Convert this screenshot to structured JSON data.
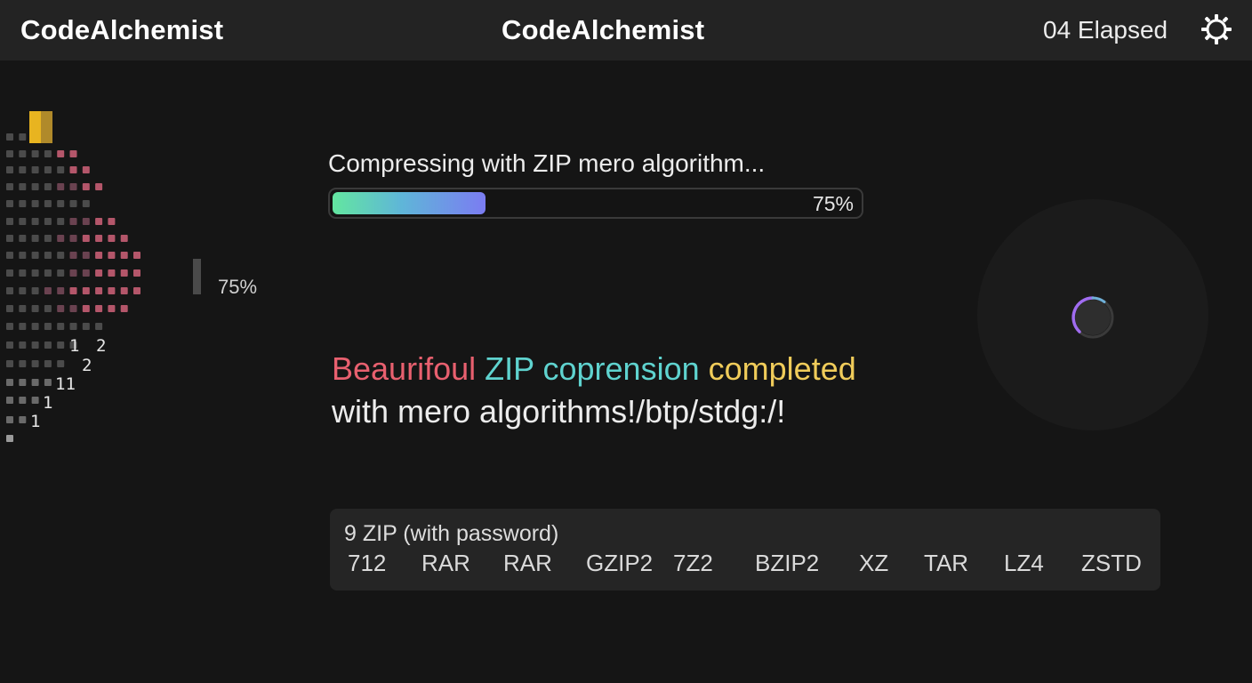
{
  "header": {
    "app_name_left": "CodeAlchemist",
    "app_name_center": "CodeAlchemist",
    "elapsed": "04 Elapsed",
    "settings_icon": "gear-icon"
  },
  "side_panel": {
    "percent": "75%",
    "grid_numbers": [
      "1",
      "2",
      "2",
      "11",
      "1",
      "1"
    ],
    "colors": {
      "bar_yellow": "#e8b420",
      "dot_pink": "#b4566a",
      "dot_gray": "#4b4b4b"
    }
  },
  "compress": {
    "label": "Compressing with ZIP mero algorithm...",
    "progress": 0.75,
    "progress_text": "75%"
  },
  "message": {
    "line1_parts": [
      {
        "text": "Beaurifoul",
        "color": "#e8606f"
      },
      {
        "text": "ZIP",
        "color": "#5fd3cf"
      },
      {
        "text": "coprension",
        "color": "#5fd3cf"
      },
      {
        "text": "completed",
        "color": "#f0cc5a"
      }
    ],
    "line2": "with mero algorithms!/btp/stdg:/!"
  },
  "spinner": {
    "icon": "loading-spinner-icon",
    "accent": "#a06cf0"
  },
  "formats": {
    "title": "9 ZIP (with password)",
    "items": [
      "712",
      "RAR",
      "RAR",
      "GZIP2",
      "7Z2",
      "BZIP2",
      "XZ",
      "TAR",
      "LZ4",
      "ZSTD"
    ]
  }
}
